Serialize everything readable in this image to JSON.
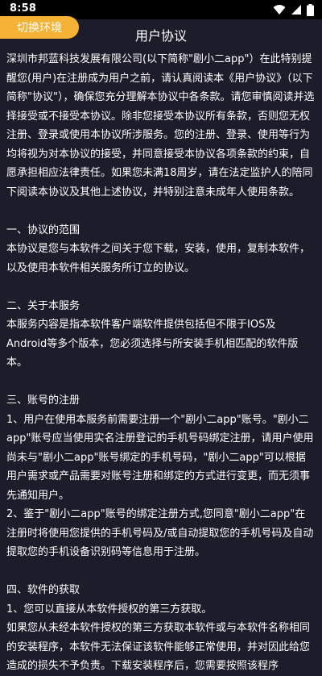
{
  "status_bar": {
    "time": "8:58",
    "icons": [
      "wifi-icon",
      "signal-icon",
      "battery-icon"
    ]
  },
  "header": {
    "env_button_label": "切换环境",
    "title": "用户协议"
  },
  "agreement": {
    "intro": "深圳市邦蓝科技发展有限公司(以下简称\"剧小二app\"）在此特别提醒您(用户)在注册成为用户之前，请认真阅读本《用户协议》（以下简称\"协议\"），确保您充分理解本协议中各条款。请您审慎阅读并选择接受或不接受本协议。除非您接受本协议所有条款，否则您无权注册、登录或使用本协议所涉服务。您的注册、登录、使用等行为均将视为对本协议的接受，并同意接受本协议各项条款的约束，自愿承担相应法律责任。如果您未满18周岁，请在法定监护人的陪同下阅读本协议及其他上述协议，并特别注意未成年人使用条款。",
    "s1_title": "一、协议的范围",
    "s1_body": "本协议是您与本软件之间关于您下载，安装，使用，复制本软件，以及使用本软件相关服务所订立的协议。",
    "s2_title": "二、关于本服务",
    "s2_body": "本服务内容是指本软件客户端软件提供包括但不限于IOS及Android等多个版本，您必须选择与所安装手机相匹配的软件版本。",
    "s3_title": "三、账号的注册",
    "s3_p1": "1、用户在使用本服务前需要注册一个\"剧小二app\"账号。\"剧小二app\"账号应当使用实名注册登记的手机号码绑定注册，请用户使用尚未与\"剧小二app\"账号绑定的手机号码，\"剧小二app\"可以根据用户需求或产品需要对账号注册和绑定的方式进行变更，而无须事先通知用户。",
    "s3_p2": "2、鉴于\"剧小二app\"账号的绑定注册方式,您同意\"剧小二app\"在注册时将使用您提供的手机号码及/或自动提取您的手机号码及自动提取您的手机设备识别码等信息用于注册。",
    "s4_title": "四、软件的获取",
    "s4_p1": "1、您可以直接从本软件授权的第三方获取。",
    "s4_p2": "如果您从未经本软件授权的第三方获取本软件或与本软件名称相同的安装程序，本软件无法保证该软件能够正常使用，并对因此给您造成的损失不予负责。下载安装程序后，您需要按照该程序"
  }
}
